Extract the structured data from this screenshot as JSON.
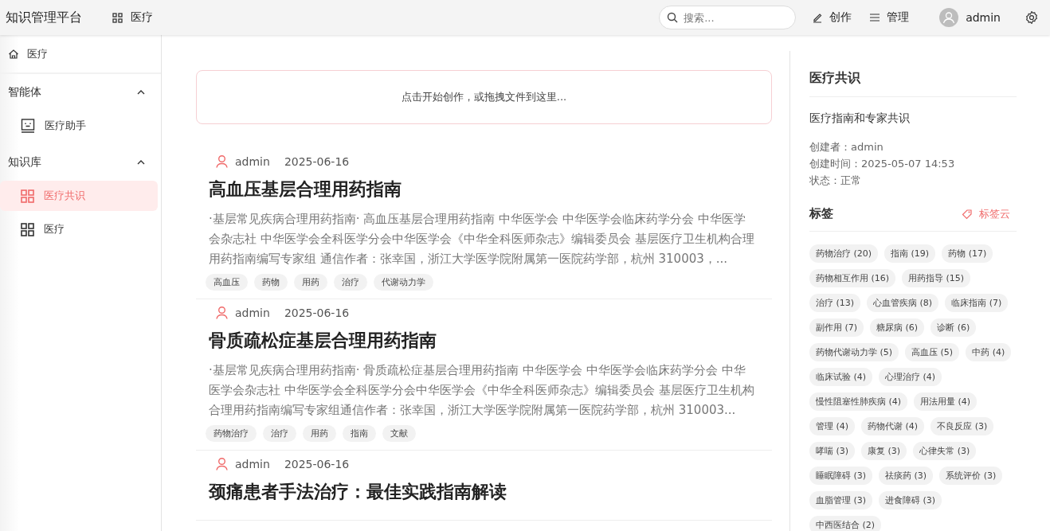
{
  "header": {
    "brand": "知识管理平台",
    "breadcrumb": "医疗",
    "search": {
      "placeholder": "搜索..."
    },
    "actions": [
      {
        "label": "创作",
        "kind": "pen"
      },
      {
        "label": "管理",
        "kind": "menu"
      }
    ],
    "user": "admin"
  },
  "sidebar": {
    "home": "医疗",
    "groups": [
      {
        "label": "智能体",
        "expanded": true,
        "items": [
          {
            "label": "医疗助手",
            "kind": "bot",
            "selected": false
          }
        ]
      },
      {
        "label": "知识库",
        "expanded": true,
        "items": [
          {
            "label": "医疗共识",
            "kind": "grid",
            "selected": true
          },
          {
            "label": "医疗",
            "kind": "grid",
            "selected": false
          }
        ]
      }
    ]
  },
  "composer": {
    "placeholder": "点击开始创作，或拖拽文件到这里..."
  },
  "articles": [
    {
      "author": "admin",
      "date": "2025-06-16",
      "title": "高血压基层合理用药指南",
      "excerpt": "·基层常见疾病合理用药指南· 高血压基层合理用药指南 中华医学会 中华医学会临床药学分会 中华医学会杂志社 中华医学会全科医学分会中华医学会《中华全科医师杂志》编辑委员会 基层医疗卫生机构合理用药指南编写专家组 通信作者：张幸国，浙江大学医学院附属第一医院药学部，杭州 310003，...",
      "tags": [
        "高血压",
        "药物",
        "用药",
        "治疗",
        "代谢动力学"
      ]
    },
    {
      "author": "admin",
      "date": "2025-06-16",
      "title": "骨质疏松症基层合理用药指南",
      "excerpt": "·基层常见疾病合理用药指南· 骨质疏松症基层合理用药指南 中华医学会 中华医学会临床药学分会 中华医学会杂志社 中华医学会全科医学分会中华医学会《中华全科医师杂志》编辑委员会 基层医疗卫生机构合理用药指南编写专家组通信作者：张幸国，浙江大学医学院附属第一医院药学部，杭州 310003...",
      "tags": [
        "药物治疗",
        "治疗",
        "用药",
        "指南",
        "文献"
      ]
    },
    {
      "author": "admin",
      "date": "2025-06-16",
      "title": "颈痛患者手法治疗：最佳实践指南解读"
    }
  ],
  "panel": {
    "title": "医疗共识",
    "description": "医疗指南和专家共识",
    "meta": [
      "创建者：admin",
      "创建时间：2025-05-07 14:53",
      "状态：正常"
    ],
    "tags_title": "标签",
    "tag_cloud_link": "标签云",
    "tags": [
      "药物治疗 (20)",
      "指南 (19)",
      "药物 (17)",
      "药物相互作用 (16)",
      "用药指导 (15)",
      "治疗 (13)",
      "心血管疾病 (8)",
      "临床指南 (7)",
      "副作用 (7)",
      "糖尿病 (6)",
      "诊断 (6)",
      "药物代谢动力学 (5)",
      "高血压 (5)",
      "中药 (4)",
      "临床试验 (4)",
      "心理治疗 (4)",
      "慢性阻塞性肺疾病 (4)",
      "用法用量 (4)",
      "管理 (4)",
      "药物代谢 (4)",
      "不良反应 (3)",
      "哮喘 (3)",
      "康复 (3)",
      "心律失常 (3)",
      "睡眠障碍 (3)",
      "祛痰药 (3)",
      "系统评价 (3)",
      "血脂管理 (3)",
      "进食障碍 (3)",
      "中西医结合 (2)"
    ]
  }
}
